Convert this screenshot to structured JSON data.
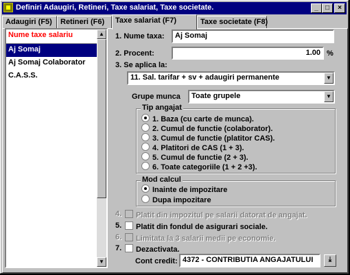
{
  "window": {
    "title": "Definiri Adaugiri, Retineri, Taxe salariat, Taxe societate."
  },
  "tabs": [
    {
      "label": "Adaugiri (F5)"
    },
    {
      "label": "Retineri (F6)"
    },
    {
      "label": "Taxe salariat (F7)"
    },
    {
      "label": "Taxe societate (F8)"
    }
  ],
  "list": {
    "header": "Nume taxe salariu",
    "items": [
      "Aj Somaj",
      "Aj Somaj Colaborator",
      "C.A.S.S."
    ],
    "selected_index": 0
  },
  "form": {
    "nume_label": "1. Nume taxa:",
    "nume_value": "Aj Somaj",
    "procent_label": "2. Procent:",
    "procent_value": "1.00",
    "procent_unit": "%",
    "aplica_label": "3. Se aplica la:",
    "aplica_value": "11. Sal. tarifar + sv + adaugiri permanente",
    "grupe_label": "Grupe munca",
    "grupe_value": "Toate grupele",
    "tip_title": "Tip angajat",
    "tip_options": [
      "1. Baza (cu carte de munca).",
      "2. Cumul de functie (colaborator).",
      "3. Cumul de functie (platitor CAS).",
      "4. Platitori de CAS (1 + 3).",
      "5. Cumul de functie (2 + 3).",
      "6. Toate categoriile (1 + 2 +3)."
    ],
    "tip_selected": 0,
    "mod_title": "Mod calcul",
    "mod_options": [
      "Inainte de impozitare",
      "Dupa impozitare"
    ],
    "mod_selected": 0,
    "opt4_num": "4.",
    "opt4_label": "Platit din impozitul pe salarii datorat de angajat.",
    "opt5_num": "5.",
    "opt5_label": "Platit din fondul de asigurari sociale.",
    "opt6_num": "6.",
    "opt6_label": "Limitata la 3 salarii medii pe economie.",
    "opt7_num": "7.",
    "opt7_label": "Dezactivata.",
    "cont_label": "Cont credit:",
    "cont_value": "4372 - CONTRIBUTIA ANGAJATULUI"
  }
}
